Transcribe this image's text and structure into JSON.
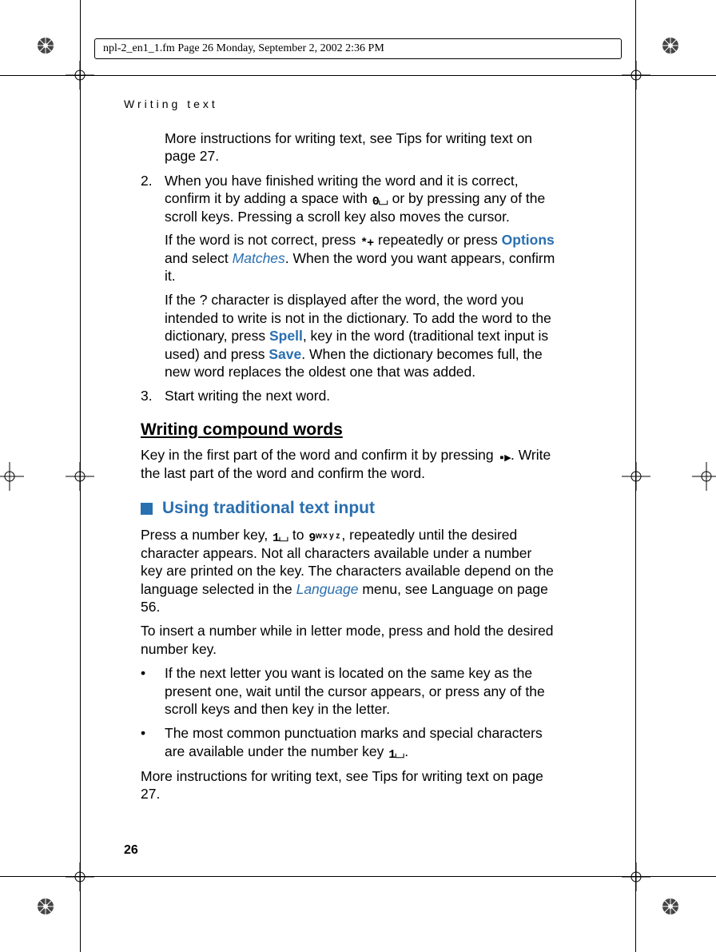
{
  "meta": {
    "header": "npl-2_en1_1.fm  Page 26  Monday, September 2, 2002  2:36 PM"
  },
  "running_head": "Writing text",
  "page_number": "26",
  "body": {
    "intro_more": "More instructions for writing text, see Tips for writing text on page 27.",
    "step2_num": "2.",
    "step2_a": "When you have finished writing the word and it is correct, confirm it by adding a space with ",
    "step2_b": " or by pressing any of the scroll keys. Pressing a scroll key also moves the cursor.",
    "step2_p2_a": "If the word is not correct, press ",
    "step2_p2_b": " repeatedly or press ",
    "step2_p2_c": " and select ",
    "step2_p2_d": ". When the word you want appears, confirm it.",
    "step2_p3_a": "If the ? character is displayed after the word, the word you intended to write is not in the dictionary. To add the word to the dictionary, press ",
    "step2_p3_b": ", key in the word (traditional text input is used) and press ",
    "step2_p3_c": ". When the dictionary becomes full, the new word replaces the oldest one that was added.",
    "step3_num": "3.",
    "step3": "Start writing the next word.",
    "h_compound": "Writing compound words",
    "compound_a": "Key in the first part of the word and confirm it by pressing ",
    "compound_b": ". Write the last part of the word and confirm the word.",
    "h_trad": "Using traditional text input",
    "trad_p1_a": "Press a number key, ",
    "trad_p1_b": " to ",
    "trad_p1_c": ", repeatedly until the desired character appears. Not all characters available under a number key are printed on the key. The characters available depend on the language selected in the ",
    "trad_p1_d": " menu, see Language on page 56.",
    "trad_p2": "To insert a number while in letter mode, press and hold the desired number key.",
    "bul1": "If the next letter you want is located on the same key as the present one, wait until the cursor appears, or press any of the scroll keys and then key in the letter.",
    "bul2_a": " The most common punctuation marks and special characters are available under the number key ",
    "bul2_b": ".",
    "trad_more": "More instructions for writing text, see Tips for writing text on page 27.",
    "ui": {
      "options": "Options",
      "matches": "Matches",
      "spell": "Spell",
      "save": "Save",
      "language": "Language"
    },
    "icons": {
      "key0": "0⌴",
      "star": "*+",
      "right": "▪▸",
      "key1": "1⌴",
      "key9": "9ʷˣʸᶻ"
    },
    "bullet_char": "•"
  }
}
